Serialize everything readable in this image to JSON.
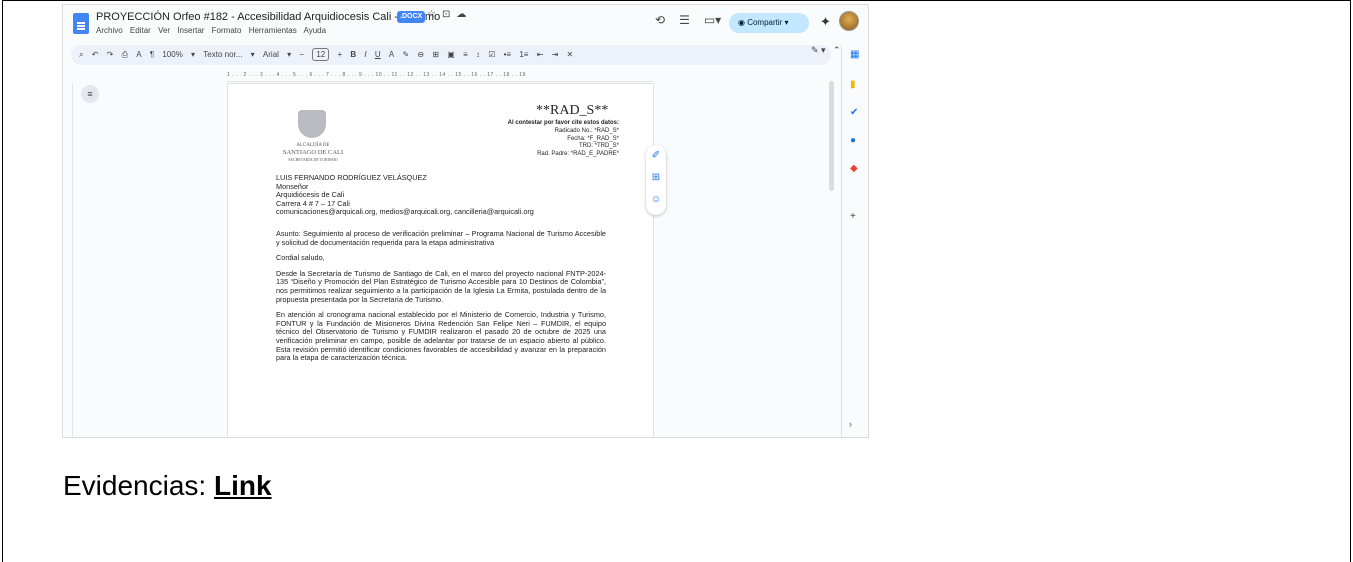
{
  "window": {
    "title": "PROYECCIÓN Orfeo #182 - Accesibilidad Arquidiocesis Cali - Turismo",
    "badge": ".DOCX",
    "menu": [
      "Archivo",
      "Editar",
      "Ver",
      "Insertar",
      "Formato",
      "Herramientas",
      "Ayuda"
    ],
    "share_label": "Compartir"
  },
  "toolbar": {
    "zoom": "100%",
    "style": "Texto nor...",
    "font": "Arial",
    "size": "12"
  },
  "ruler": "1 . . . 2 . . . 3 . . . 4 . . . 5 . . . 6 . . . 7 . . . 8 . . . 9 . . . 10 . . 11 . . 12 . . 13 . . 14 . . 15 . . 16 . . 17 . . 18 . . 19",
  "document": {
    "crest": {
      "line1": "ALCALDÍA DE",
      "line2": "SANTIAGO DE CALI",
      "line3": "SECRETARÍA DE TURISMO"
    },
    "rad_title": "**RAD_S**",
    "rad_intro": "Al contestar por favor cite estos datos:",
    "rad_lines": [
      "Radicado No.: *RAD_S*",
      "Fecha: *F_RAD_S*",
      "TRD: *TRD_S*",
      "Rad. Padre: *RAD_E_PADRE*"
    ],
    "address": [
      "LUIS FERNANDO RODRÍGUEZ VELÁSQUEZ",
      "Monseñor",
      "Arquidiócesis de Cali",
      "Carrera 4 # 7 – 17 Cali",
      "comunicaciones@arquicali.org, medios@arquicali.org, cancilleria@arquicali.org"
    ],
    "asunto": "Asunto: Seguimiento al proceso de verificación preliminar – Programa Nacional de Turismo Accesible y solicitud de documentación requerida para la etapa administrativa",
    "saludo": "Cordial saludo,",
    "p1": "Desde la Secretaría de Turismo de Santiago de Cali, en el marco del proyecto nacional FNTP-2024-135 “Diseño y Promoción del Plan Estratégico de Turismo Accesible para 10 Destinos de Colombia”, nos permitimos realizar seguimiento a la participación de la Iglesia La Ermita, postulada dentro de la propuesta presentada por la Secretaría de Turismo.",
    "p2": "En atención al cronograma nacional establecido por el Ministerio de Comercio, Industria y Turismo, FONTUR y la Fundación de Misioneros Divina Redención San Felipe Neri – FUMDIR, el equipo técnico del Observatorio de Turismo y FUMDIR realizaron el pasado 20 de octubre de 2025 una verificación preliminar en campo, posible de adelantar por tratarse de un espacio abierto al público. Esta revisión permitió identificar condiciones favorables de accesibilidad y avanzar en la preparación para la etapa de caracterización técnica."
  },
  "caption": {
    "prefix": "Evidencias: ",
    "link": "Link"
  }
}
